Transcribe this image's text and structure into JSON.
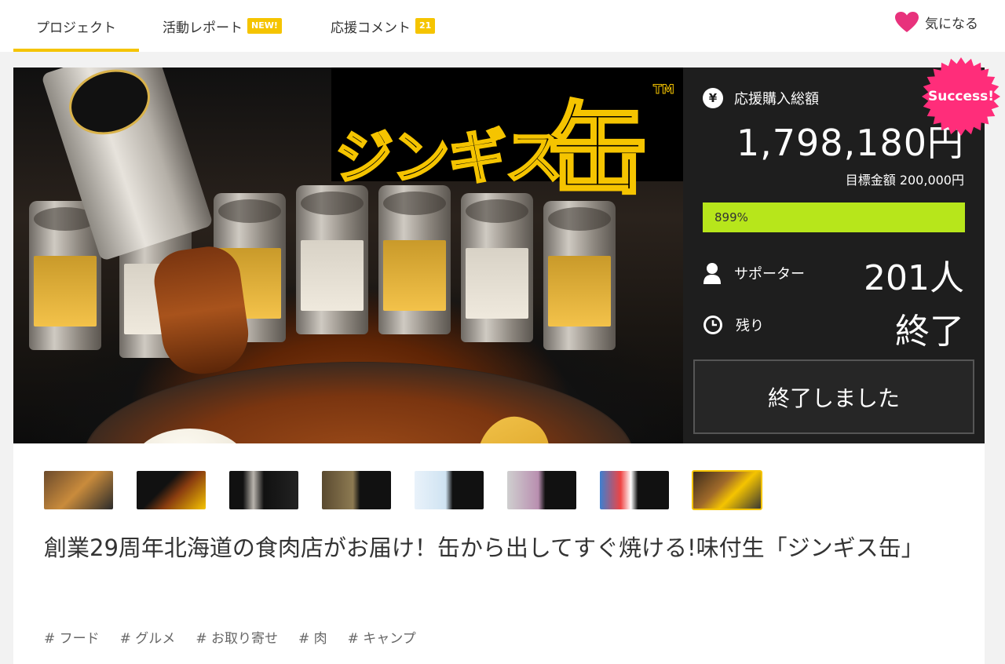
{
  "tabs": [
    {
      "label": "プロジェクト"
    },
    {
      "label": "活動レポート",
      "badge": "NEW!"
    },
    {
      "label": "応援コメント",
      "badge": "21"
    }
  ],
  "favorite_label": "気になる",
  "hero": {
    "logo_text": "ジンギス",
    "logo_kanji": "缶",
    "logo_tm": "TM"
  },
  "stats": {
    "total_label": "応援購入総額",
    "total_amount": "1,798,180円",
    "goal_text": "目標金額 200,000円",
    "progress_text": "899%",
    "progress_fraction": 1.0,
    "supporters_label": "サポーター",
    "supporters_value": "201人",
    "remaining_label": "残り",
    "remaining_value": "終了",
    "ended_button": "終了しました",
    "success_badge": "Success!"
  },
  "thumbnails": [
    {
      "name": "thumb-1"
    },
    {
      "name": "thumb-2"
    },
    {
      "name": "thumb-3"
    },
    {
      "name": "thumb-4"
    },
    {
      "name": "thumb-5"
    },
    {
      "name": "thumb-6"
    },
    {
      "name": "thumb-7"
    },
    {
      "name": "thumb-8",
      "selected": true
    }
  ],
  "title": "創業29周年北海道の食肉店がお届け！缶から出してすぐ焼ける!味付生「ジンギス缶」",
  "tags": [
    "# フード",
    "# グルメ",
    "# お取り寄せ",
    "# 肉",
    "# キャンプ"
  ],
  "colors": {
    "accent": "#f5c400",
    "progress": "#b7e61b",
    "favorite": "#e8327c",
    "success": "#ff2d7a",
    "panel": "#1e1e1e"
  }
}
